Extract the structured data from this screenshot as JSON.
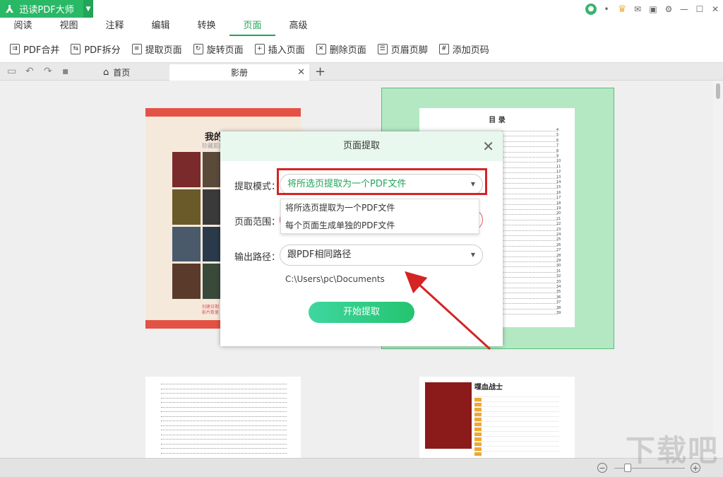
{
  "app": {
    "title": "迅读PDF大师"
  },
  "menu": {
    "items": [
      "阅读",
      "视图",
      "注释",
      "编辑",
      "转换",
      "页面",
      "高级"
    ],
    "active": "页面"
  },
  "toolbar": {
    "items": [
      "PDF合并",
      "PDF拆分",
      "提取页面",
      "旋转页面",
      "插入页面",
      "删除页面",
      "页眉页脚",
      "添加页码"
    ]
  },
  "tabs": {
    "home": "首页",
    "doc": "影册"
  },
  "page1": {
    "title": "我的影册",
    "subtitle": "珍藏影片",
    "foot": [
      "创建日期",
      "影片数量"
    ]
  },
  "toc": {
    "title": "目 录",
    "numbers": [
      "4",
      "5",
      "6",
      "7",
      "8",
      "9",
      "10",
      "11",
      "12",
      "13",
      "14",
      "15",
      "16",
      "17",
      "18",
      "19",
      "20",
      "21",
      "22",
      "23",
      "24",
      "25",
      "26",
      "27",
      "28",
      "29",
      "30",
      "31",
      "32",
      "33",
      "34",
      "35",
      "36",
      "37",
      "38",
      "39"
    ]
  },
  "page4": {
    "title": "喋血战士"
  },
  "dialog": {
    "title": "页面提取",
    "mode_label": "提取模式：",
    "mode_value": "将所选页提取为一个PDF文件",
    "options": [
      "将所选页提取为一个PDF文件",
      "每个页面生成单独的PDF文件"
    ],
    "range_label": "页面范围：",
    "output_label": "输出路径：",
    "output_value": "跟PDF相同路径",
    "path": "C:\\Users\\pc\\Documents",
    "start_button": "开始提取"
  },
  "watermark": "下载吧",
  "colors": {
    "brand": "#29b866",
    "highlight": "#d42424",
    "selection": "#b3e8c3"
  }
}
